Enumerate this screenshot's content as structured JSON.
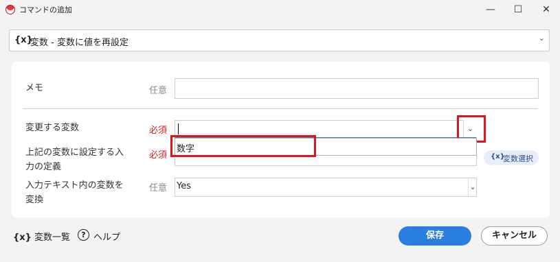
{
  "window": {
    "title": "コマンドの追加",
    "minimize_glyph": "—",
    "maximize_glyph": "☐",
    "close_glyph": "✕"
  },
  "command_select": {
    "icon": "{x}",
    "text": "変数 - 変数に値を再設定",
    "chevron": "⌄"
  },
  "form": {
    "memo": {
      "label": "メモ",
      "requirement": "任意",
      "value": ""
    },
    "variable": {
      "label": "変更する変数",
      "requirement": "必須",
      "value": "",
      "dropdown_glyph": "⌄"
    },
    "dropdown_options": [
      "数字"
    ],
    "definition": {
      "label_line1": "上記の変数に設定する入",
      "label_line2": "力の定義",
      "requirement": "必須",
      "value": ""
    },
    "variable_select_button": {
      "icon": "{x}",
      "label": "変数選択"
    },
    "expand_vars": {
      "label_line1": "入力テキスト内の変数を",
      "label_line2": "変換",
      "requirement": "任意",
      "value": "Yes",
      "chevron": "⌄"
    }
  },
  "footer": {
    "variable_list": {
      "icon": "{x}",
      "label": "変数一覧"
    },
    "help": {
      "icon": "?",
      "label": "ヘルプ"
    },
    "save_label": "保存",
    "cancel_label": "キャンセル"
  },
  "colors": {
    "accent": "#2b7de0",
    "required": "#d21f1f",
    "highlight": "#e0141b"
  }
}
